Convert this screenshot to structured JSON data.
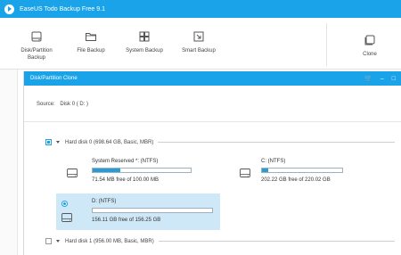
{
  "app": {
    "title": "EaseUS Todo Backup Free 9.1"
  },
  "toolbar": {
    "disk_partition_backup": "Disk/Partition\nBackup",
    "file_backup": "File Backup",
    "system_backup": "System Backup",
    "smart_backup": "Smart Backup",
    "clone": "Clone"
  },
  "dialog": {
    "title": "Disk/Partition Clone",
    "source_label": "Source:",
    "source_value": "Disk 0 ( D: )"
  },
  "disks": [
    {
      "label": "Hard disk 0 (698.64 GB, Basic, MBR)",
      "checked": true,
      "partitions": [
        {
          "name": "System Reserved *: (NTFS)",
          "free": "71.54 MB free of 100.00 MB",
          "used_fraction": 0.28,
          "selected": false
        },
        {
          "name": "C: (NTFS)",
          "free": "202.22 GB free of 220.02 GB",
          "used_fraction": 0.08,
          "selected": false
        },
        {
          "name": "D: (NTFS)",
          "free": "156.11 GB free of 156.25 GB",
          "used_fraction": 0.0,
          "selected": true
        }
      ]
    },
    {
      "label": "Hard disk 1 (956.00 MB, Basic, MBR)",
      "checked": false
    }
  ],
  "colors": {
    "accent": "#1aa3e8",
    "selection": "#cfe8f7",
    "bar_fill": "#2a9bd5"
  }
}
